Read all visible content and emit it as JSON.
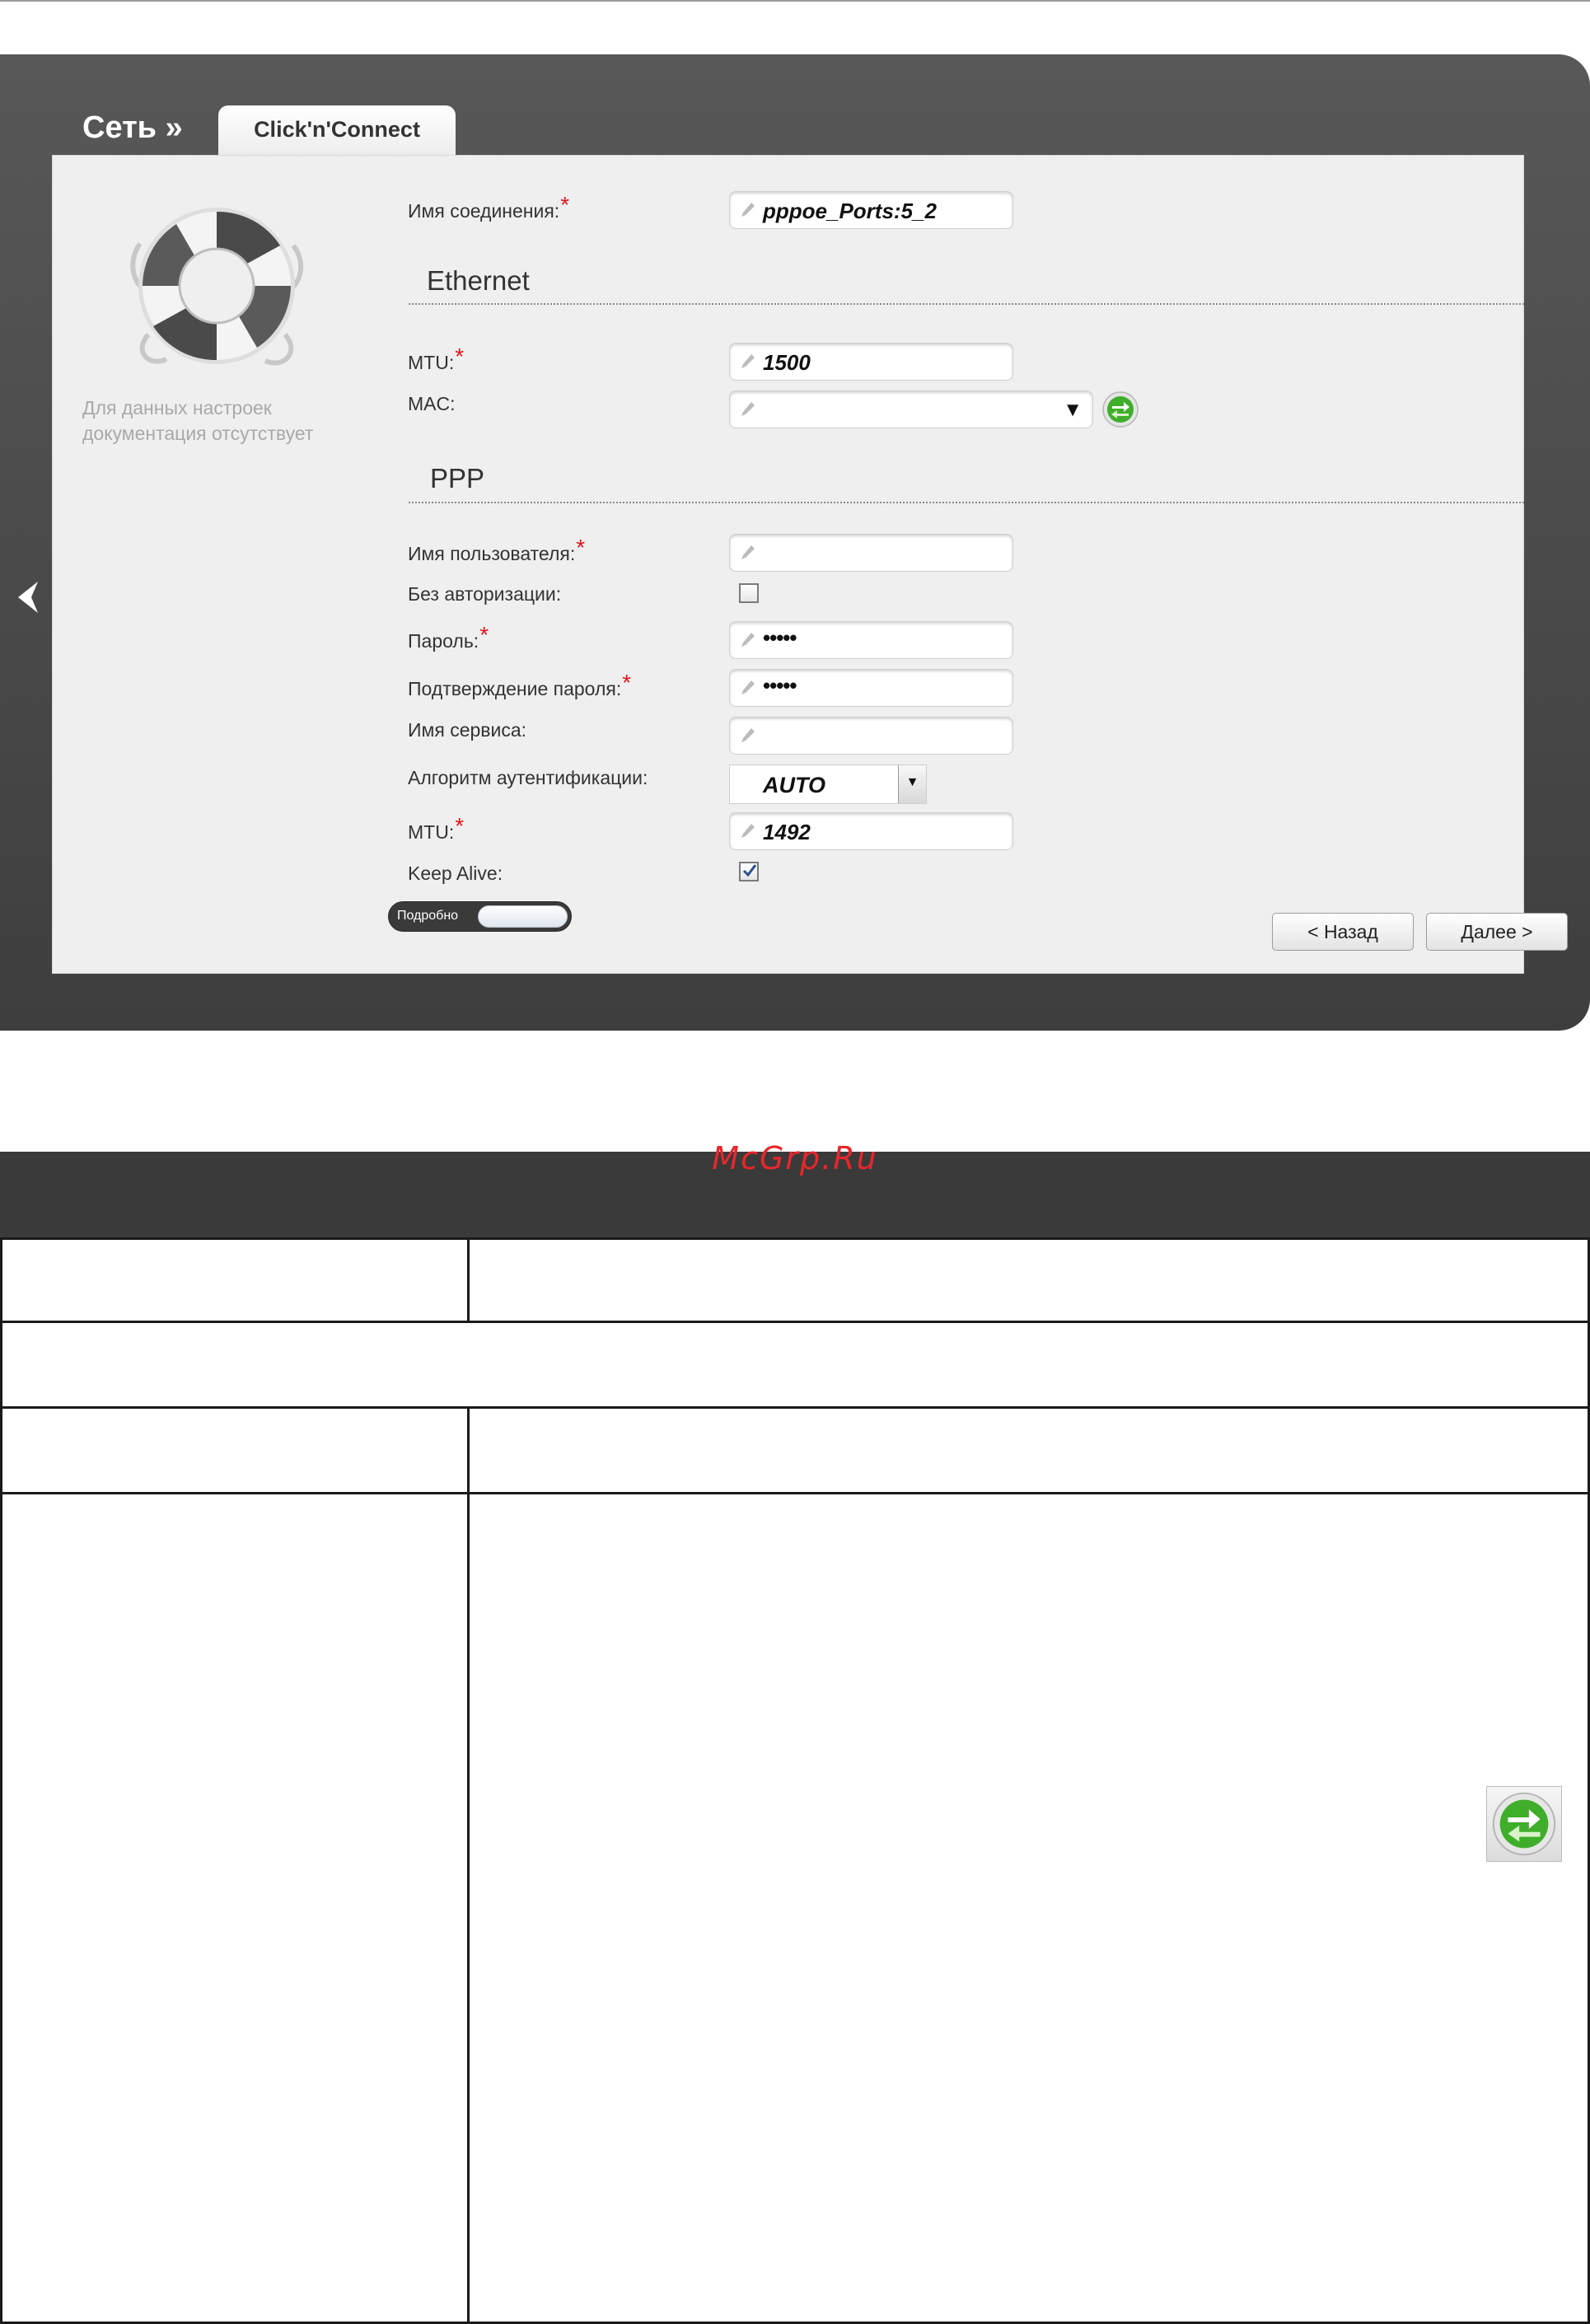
{
  "breadcrumb": {
    "section": "Сеть »",
    "tab": "Click'n'Connect"
  },
  "sidebar": {
    "no_doc_text": "Для данных настроек документация отсутствует"
  },
  "connection": {
    "label": "Имя соединения:",
    "value": "pppoe_Ports:5_2"
  },
  "ethernet": {
    "title": "Ethernet",
    "mtu_label": "MTU:",
    "mtu_value": "1500",
    "mac_label": "MAC:",
    "mac_value": ""
  },
  "ppp": {
    "title": "PPP",
    "username_label": "Имя пользователя:",
    "username_value": "",
    "no_auth_label": "Без авторизации:",
    "no_auth_checked": false,
    "password_label": "Пароль:",
    "password_value": "•••••",
    "confirm_label": "Подтверждение пароля:",
    "confirm_value": "•••••",
    "service_label": "Имя сервиса:",
    "service_value": "",
    "auth_label": "Алгоритм аутентификации:",
    "auth_value": "AUTO",
    "mtu_label": "MTU:",
    "mtu_value": "1492",
    "keepalive_label": "Keep Alive:",
    "keepalive_checked": true
  },
  "required_mark": "*",
  "toggle": {
    "label": "Подробно"
  },
  "buttons": {
    "back": "< Назад",
    "next": "Далее >"
  },
  "icons": {
    "back": "chevron-left-icon",
    "help": "lifebuoy-icon",
    "edit": "pencil-icon",
    "refresh": "green-arrows-icon",
    "dropdown": "triangle-down-icon"
  },
  "watermark": "McGrp.Ru",
  "colors": {
    "required": "#e0161b",
    "frame": "#4a4a4a",
    "panel": "#efefef",
    "table_header": "#3a3a3a"
  }
}
